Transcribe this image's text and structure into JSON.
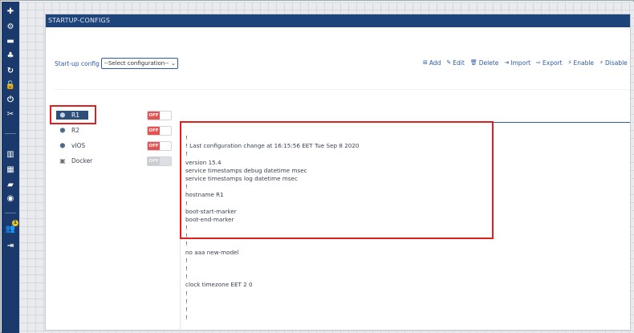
{
  "window": {
    "title": "STARTUP-CONFIGS"
  },
  "colors": {
    "sidebar": "#1b3a6b",
    "titlebar": "#1f4479",
    "accent": "#2e5aa8",
    "off_toggle": "#e55050",
    "highlight": "#e02020"
  },
  "sidebar": {
    "icons": [
      {
        "name": "add-icon",
        "glyph": "✚"
      },
      {
        "name": "cogs-icon",
        "glyph": "⚙"
      },
      {
        "name": "server-icon",
        "glyph": "▬"
      },
      {
        "name": "cluster-icon",
        "glyph": "♣"
      },
      {
        "name": "refresh-icon",
        "glyph": "↻"
      },
      {
        "name": "lock-icon",
        "glyph": "🔓"
      },
      {
        "name": "power-icon",
        "glyph": "⏻"
      },
      {
        "name": "tools-icon",
        "glyph": "✂"
      },
      {
        "name": "chart-icon",
        "glyph": "▥"
      },
      {
        "name": "map-icon",
        "glyph": "▦"
      },
      {
        "name": "book-icon",
        "glyph": "▰"
      },
      {
        "name": "toggle-icon",
        "glyph": "◉"
      },
      {
        "name": "users-icon",
        "glyph": "👥"
      },
      {
        "name": "logout-icon",
        "glyph": "⇥"
      }
    ],
    "badge": "1"
  },
  "config_selector": {
    "label": "Start-up config",
    "selected": "--Select configuration--",
    "caret": "⌄"
  },
  "toolbar": {
    "add": {
      "icon": "⊞",
      "label": "Add"
    },
    "edit": {
      "icon": "✎",
      "label": "Edit"
    },
    "delete": {
      "icon": "🗑",
      "label": "Delete"
    },
    "import": {
      "icon": "⇥",
      "label": "Import"
    },
    "export": {
      "icon": "⇨",
      "label": "Export"
    },
    "enable": {
      "icon": "⚡",
      "label": "Enable"
    },
    "disable": {
      "icon": "⚡",
      "label": "Disable"
    }
  },
  "devices": [
    {
      "name": "R1",
      "icon": "router-icon",
      "glyph": "⬢",
      "toggle": "OFF",
      "selected": true,
      "disabled": false
    },
    {
      "name": "R2",
      "icon": "router-icon",
      "glyph": "⬢",
      "toggle": "OFF",
      "selected": false,
      "disabled": false
    },
    {
      "name": "vIOS",
      "icon": "router-icon",
      "glyph": "⬢",
      "toggle": "OFF",
      "selected": false,
      "disabled": false
    },
    {
      "name": "Docker",
      "icon": "docker-icon",
      "glyph": "▣",
      "toggle": "OFF",
      "selected": false,
      "disabled": true
    }
  ],
  "config_lines": [
    "!",
    "! Last configuration change at 16:15:56 EET Tue Sep 8 2020",
    "!",
    "version 15.4",
    "service timestamps debug datetime msec",
    "service timestamps log datetime msec",
    "!",
    "hostname R1",
    "!",
    "boot-start-marker",
    "boot-end-marker",
    "!",
    "!",
    "!",
    "no aaa new-model",
    "!",
    "!",
    "!",
    "clock timezone EET 2 0",
    "!",
    "!",
    "!",
    "!"
  ]
}
